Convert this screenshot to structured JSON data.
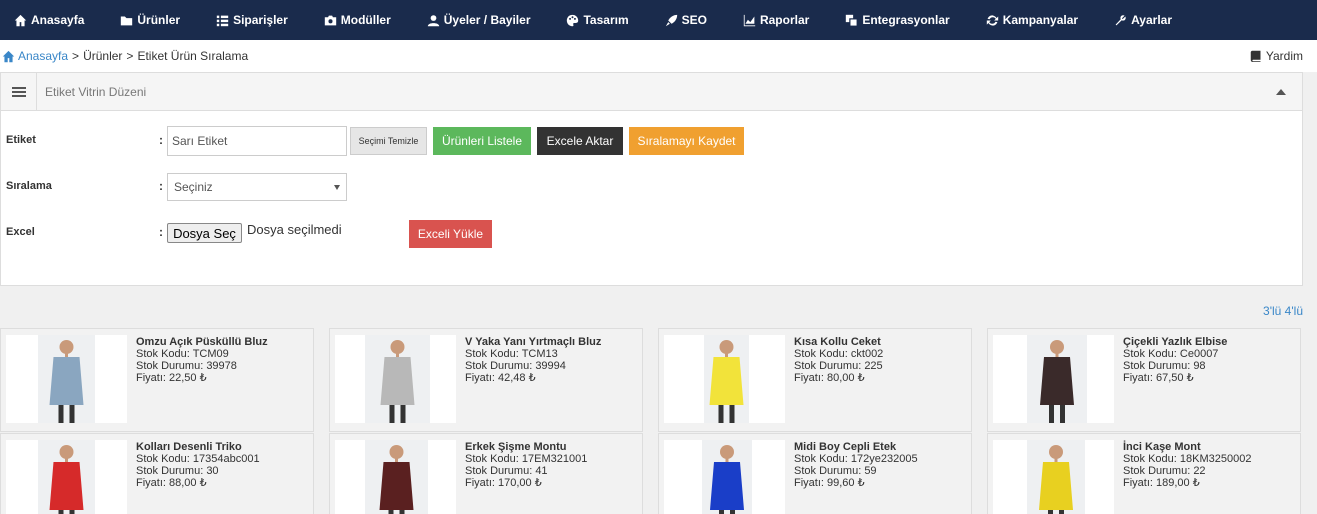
{
  "nav": [
    {
      "icon": "home-icon",
      "label": "Anasayfa"
    },
    {
      "icon": "folder-icon",
      "label": "Ürünler"
    },
    {
      "icon": "list-icon",
      "label": "Siparişler"
    },
    {
      "icon": "module-icon",
      "label": "Modüller"
    },
    {
      "icon": "user-icon",
      "label": "Üyeler / Bayiler"
    },
    {
      "icon": "palette-icon",
      "label": "Tasarım"
    },
    {
      "icon": "rocket-icon",
      "label": "SEO"
    },
    {
      "icon": "chart-icon",
      "label": "Raporlar"
    },
    {
      "icon": "integration-icon",
      "label": "Entegrasyonlar"
    },
    {
      "icon": "refresh-icon",
      "label": "Kampanyalar"
    },
    {
      "icon": "wrench-icon",
      "label": "Ayarlar"
    }
  ],
  "breadcrumb": {
    "home": "Anasayfa",
    "sep": ">",
    "level1": "Ürünler",
    "level2": "Etiket Ürün Sıralama"
  },
  "help_label": "Yardim",
  "panel": {
    "title": "Etiket Vitrin Düzeni",
    "tag_label": "Etiket",
    "order_label": "Sıralama",
    "excel_label": "Excel",
    "colon": ":",
    "tag_value": "Sarı Etiket",
    "clear_button": "Seçimi Temizle",
    "list_button": "Ürünleri Listele",
    "export_button": "Excele Aktar",
    "save_button": "Sıralamayı Kaydet",
    "select_value": "Seçiniz",
    "file_button": "Dosya Seç",
    "file_status": "Dosya seçilmedi",
    "upload_button": "Exceli Yükle"
  },
  "layout_toggle": "3'lü 4'lü",
  "product_labels": {
    "code": "Stok Kodu:",
    "stock": "Stok Durumu:",
    "price": "Fiyatı:"
  },
  "products": [
    {
      "name": "Omzu Açık Püsküllü Bluz",
      "code": "TCM09",
      "stock": "39978",
      "price": "22,50 ₺",
      "color": "#8aa6c0"
    },
    {
      "name": "V Yaka Yanı Yırtmaçlı Bluz",
      "code": "TCM13",
      "stock": "39994",
      "price": "42,48 ₺",
      "color": "#b8b8b8"
    },
    {
      "name": "Kısa Kollu Ceket",
      "code": "ckt002",
      "stock": "225",
      "price": "80,00 ₺",
      "color": "#f2e33a"
    },
    {
      "name": "Çiçekli Yazlık Elbise",
      "code": "Ce0007",
      "stock": "98",
      "price": "67,50 ₺",
      "color": "#3a2a2a"
    },
    {
      "name": "Kolları Desenli Triko",
      "code": "17354abc001",
      "stock": "30",
      "price": "88,00 ₺",
      "color": "#d62a2a"
    },
    {
      "name": "Erkek Şişme Montu",
      "code": "17EM321001",
      "stock": "41",
      "price": "170,00 ₺",
      "color": "#5a2020"
    },
    {
      "name": "Midi Boy Cepli Etek",
      "code": "172ye232005",
      "stock": "59",
      "price": "99,60 ₺",
      "color": "#1a3ec8"
    },
    {
      "name": "İnci Kaşe Mont",
      "code": "18KM3250002",
      "stock": "22",
      "price": "189,00 ₺",
      "color": "#e8d020"
    }
  ]
}
